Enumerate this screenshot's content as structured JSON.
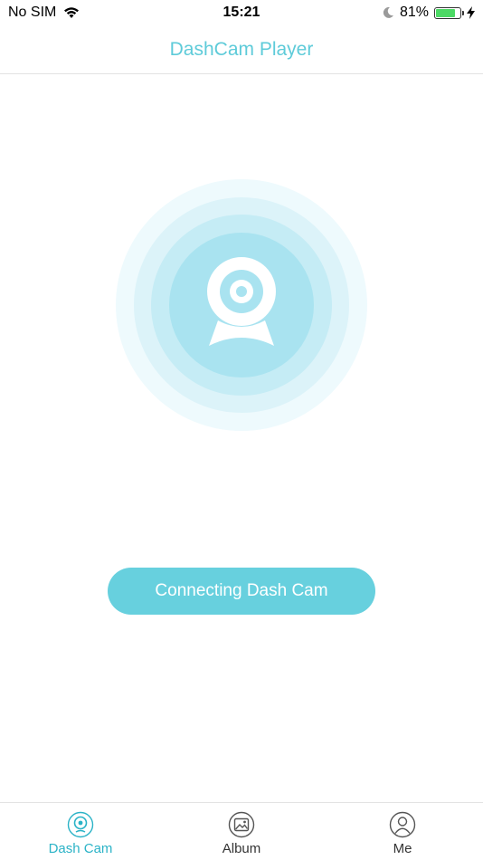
{
  "status_bar": {
    "carrier": "No SIM",
    "time": "15:21",
    "battery_percent": "81%",
    "battery_level": 0.81,
    "icons": [
      "wifi-icon",
      "moon-icon",
      "battery-icon",
      "charging-bolt-icon"
    ]
  },
  "nav": {
    "title": "DashCam Player"
  },
  "hero": {
    "icon": "dashcam-icon"
  },
  "connect_button": {
    "label": "Connecting Dash Cam"
  },
  "tabs": [
    {
      "label": "Dash Cam",
      "icon": "dashcam-tab-icon",
      "active": true
    },
    {
      "label": "Album",
      "icon": "album-icon",
      "active": false
    },
    {
      "label": "Me",
      "icon": "person-icon",
      "active": false
    }
  ],
  "colors": {
    "accent": "#5ecbd9",
    "button": "#67d0de",
    "active_tab": "#2bb3c7"
  }
}
